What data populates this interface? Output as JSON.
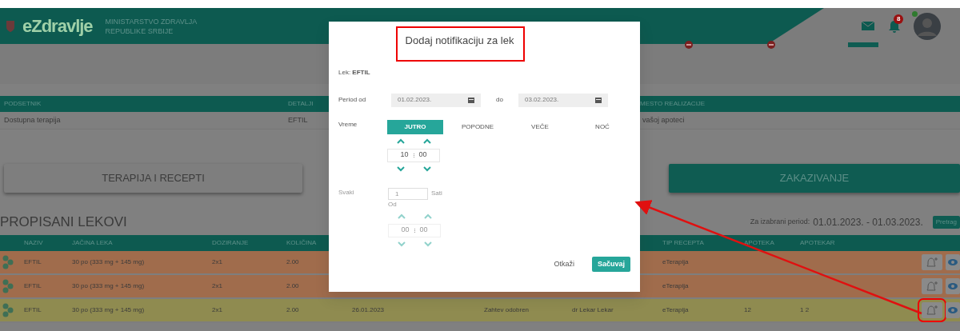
{
  "header": {
    "logo": "eZdravlje",
    "ministry": [
      "MINISTARSTVO ZDRAVLJA",
      "REPUBLIKE SRBIJE"
    ],
    "notification_count": "8",
    "online": true
  },
  "reminders": {
    "columns": [
      "PODSETNIK",
      "DETALJI",
      "MESTO REALIZACIJE"
    ],
    "rows": [
      {
        "cells": [
          "Dostupna terapija",
          "EFTIL",
          "vašoj apoteci"
        ]
      }
    ]
  },
  "tiles": [
    {
      "label": "TERAPIJA I RECEPTI",
      "selected": false
    },
    {
      "label": "ZAKAZIVANJE",
      "selected": true
    }
  ],
  "prescriptions": {
    "title": "PROPISANI LEKOVI",
    "period_label": "Za izabrani period:",
    "period": "01.01.2023. - 01.03.2023.",
    "search_button": "Pretrag",
    "columns": [
      "NAZIV",
      "JAČINA LEKA",
      "DOZIRANJE",
      "KOLIČINA",
      null,
      null,
      null,
      "TIP RECEPTA",
      "APOTEKA",
      "APOTEKAR"
    ],
    "rows": [
      {
        "color": "#a06c4c",
        "cells": [
          "EFTIL",
          "30 po (333 mg + 145 mg)",
          "2x1",
          "2.00",
          null,
          null,
          null,
          "eTerapija",
          null,
          null
        ],
        "highlighted": false
      },
      {
        "color": "#a06c4c",
        "cells": [
          "EFTIL",
          "30 po (333 mg + 145 mg)",
          "2x1",
          "2.00",
          null,
          null,
          null,
          "eTerapija",
          null,
          null
        ],
        "highlighted": false
      },
      {
        "color": "#8f8b50",
        "cells": [
          "EFTIL",
          "30 po (333 mg + 145 mg)",
          "2x1",
          "2.00",
          "26.01.2023",
          "Zahtev odobren",
          "dr Lekar Lekar",
          "eTerapija",
          "12",
          "1 2"
        ],
        "highlighted": true
      }
    ]
  },
  "modal": {
    "title": "Dodaj notifikaciju za lek",
    "lek_label": "Lek:",
    "lek": "EFTIL",
    "period_label": "Period od",
    "date_from": "01.02.2023.",
    "to_label": "do",
    "date_to": "03.02.2023.",
    "time_label": "Vreme",
    "tabs": [
      {
        "label": "JUTRO",
        "selected": true
      },
      {
        "label": "POPODNE",
        "selected": false
      },
      {
        "label": "VEČE",
        "selected": false
      },
      {
        "label": "NOĆ",
        "selected": false
      }
    ],
    "time": {
      "hours": "10",
      "minutes": "00",
      "disabled": false
    },
    "every_label": "Svaki",
    "every_value": "1",
    "every_unit": "Sati",
    "every_disabled": true,
    "from_label": "Od",
    "from_time": {
      "hours": "00",
      "minutes": "00",
      "disabled": true
    },
    "cancel": "Otkaži",
    "save": "Sačuvaj"
  }
}
